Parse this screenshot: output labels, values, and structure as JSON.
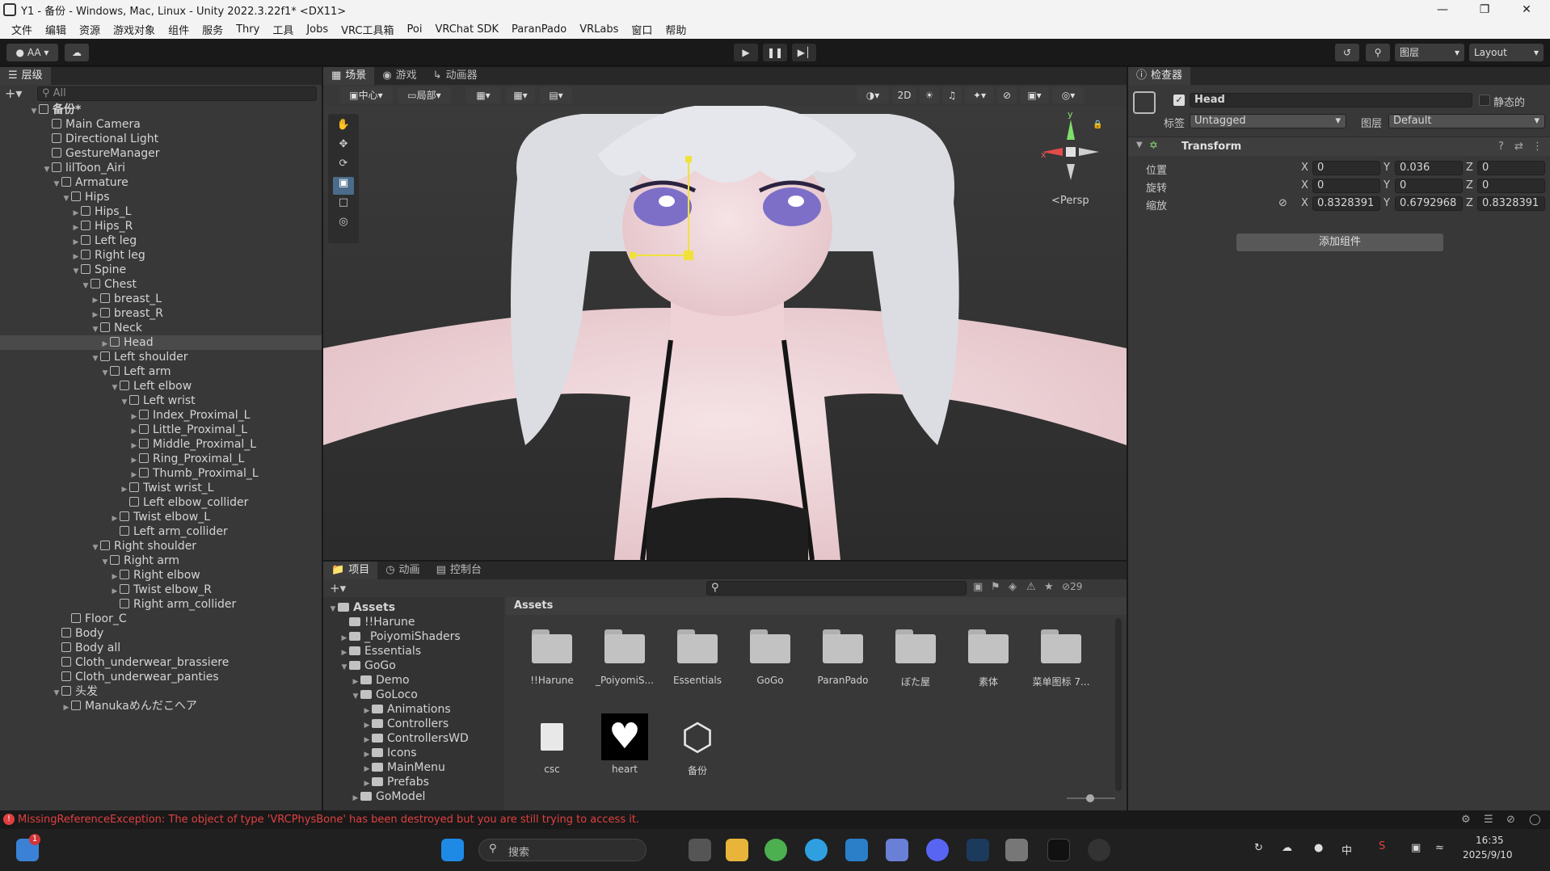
{
  "window": {
    "title": "Y1 - 备份 - Windows, Mac, Linux - Unity 2022.3.22f1* <DX11>"
  },
  "menu": [
    "文件",
    "编辑",
    "资源",
    "游戏对象",
    "组件",
    "服务",
    "Thry",
    "工具",
    "Jobs",
    "VRC工具箱",
    "Poi",
    "VRChat SDK",
    "ParanPado",
    "VRLabs",
    "窗口",
    "帮助"
  ],
  "toolbar": {
    "account": "AA",
    "layers": "图层",
    "layout": "Layout"
  },
  "hierarchy": {
    "tab": "层级",
    "search_placeholder": "All",
    "scene": "备份*",
    "items": [
      {
        "label": "Main Camera",
        "depth": 1,
        "arrow": ""
      },
      {
        "label": "Directional Light",
        "depth": 1,
        "arrow": ""
      },
      {
        "label": "GestureManager",
        "depth": 1,
        "arrow": ""
      },
      {
        "label": "lilToon_Airi",
        "depth": 1,
        "arrow": "▼"
      },
      {
        "label": "Armature",
        "depth": 2,
        "arrow": "▼"
      },
      {
        "label": "Hips",
        "depth": 3,
        "arrow": "▼"
      },
      {
        "label": "Hips_L",
        "depth": 4,
        "arrow": "▶"
      },
      {
        "label": "Hips_R",
        "depth": 4,
        "arrow": "▶"
      },
      {
        "label": "Left leg",
        "depth": 4,
        "arrow": "▶"
      },
      {
        "label": "Right leg",
        "depth": 4,
        "arrow": "▶"
      },
      {
        "label": "Spine",
        "depth": 4,
        "arrow": "▼"
      },
      {
        "label": "Chest",
        "depth": 5,
        "arrow": "▼"
      },
      {
        "label": "breast_L",
        "depth": 6,
        "arrow": "▶"
      },
      {
        "label": "breast_R",
        "depth": 6,
        "arrow": "▶"
      },
      {
        "label": "Neck",
        "depth": 6,
        "arrow": "▼"
      },
      {
        "label": "Head",
        "depth": 7,
        "arrow": "▶",
        "selected": true
      },
      {
        "label": "Left shoulder",
        "depth": 6,
        "arrow": "▼"
      },
      {
        "label": "Left arm",
        "depth": 7,
        "arrow": "▼"
      },
      {
        "label": "Left elbow",
        "depth": 8,
        "arrow": "▼"
      },
      {
        "label": "Left wrist",
        "depth": 9,
        "arrow": "▼"
      },
      {
        "label": "Index_Proximal_L",
        "depth": 10,
        "arrow": "▶"
      },
      {
        "label": "Little_Proximal_L",
        "depth": 10,
        "arrow": "▶"
      },
      {
        "label": "Middle_Proximal_L",
        "depth": 10,
        "arrow": "▶"
      },
      {
        "label": "Ring_Proximal_L",
        "depth": 10,
        "arrow": "▶"
      },
      {
        "label": "Thumb_Proximal_L",
        "depth": 10,
        "arrow": "▶"
      },
      {
        "label": "Twist wrist_L",
        "depth": 9,
        "arrow": "▶"
      },
      {
        "label": "Left elbow_collider",
        "depth": 9,
        "arrow": ""
      },
      {
        "label": "Twist elbow_L",
        "depth": 8,
        "arrow": "▶"
      },
      {
        "label": "Left arm_collider",
        "depth": 8,
        "arrow": ""
      },
      {
        "label": "Right shoulder",
        "depth": 6,
        "arrow": "▼"
      },
      {
        "label": "Right arm",
        "depth": 7,
        "arrow": "▼"
      },
      {
        "label": "Right elbow",
        "depth": 8,
        "arrow": "▶"
      },
      {
        "label": "Twist elbow_R",
        "depth": 8,
        "arrow": "▶"
      },
      {
        "label": "Right arm_collider",
        "depth": 8,
        "arrow": ""
      },
      {
        "label": "Floor_C",
        "depth": 3,
        "arrow": ""
      },
      {
        "label": "Body",
        "depth": 2,
        "arrow": ""
      },
      {
        "label": "Body all",
        "depth": 2,
        "arrow": ""
      },
      {
        "label": "Cloth_underwear_brassiere",
        "depth": 2,
        "arrow": ""
      },
      {
        "label": "Cloth_underwear_panties",
        "depth": 2,
        "arrow": ""
      },
      {
        "label": "头发",
        "depth": 2,
        "arrow": "▼"
      },
      {
        "label": "Manukaめんだこヘア",
        "depth": 3,
        "arrow": "▶"
      }
    ]
  },
  "scene_view": {
    "tabs": [
      "场景",
      "游戏",
      "动画器"
    ],
    "pivot": "中心",
    "space": "局部",
    "mode_2d": "2D",
    "persp": "<Persp",
    "axis_x": "x",
    "axis_y": "y"
  },
  "inspector": {
    "tab": "检查器",
    "object_name": "Head",
    "static_label": "静态的",
    "tag_label": "标签",
    "tag_value": "Untagged",
    "layer_label": "图层",
    "layer_value": "Default",
    "component": "Transform",
    "rows": [
      {
        "label": "位置",
        "x": "0",
        "y": "0.036",
        "z": "0"
      },
      {
        "label": "旋转",
        "x": "0",
        "y": "0",
        "z": "0"
      },
      {
        "label": "缩放",
        "x": "0.8328391",
        "y": "0.6792968",
        "z": "0.8328391"
      }
    ],
    "add_component": "添加组件"
  },
  "project": {
    "tabs": [
      "项目",
      "动画",
      "控制台"
    ],
    "hidden_count": "29",
    "tree": [
      {
        "label": "Assets",
        "depth": 0,
        "arrow": "▼",
        "bold": true
      },
      {
        "label": "!!Harune",
        "depth": 1,
        "arrow": ""
      },
      {
        "label": "_PoiyomiShaders",
        "depth": 1,
        "arrow": "▶"
      },
      {
        "label": "Essentials",
        "depth": 1,
        "arrow": "▶"
      },
      {
        "label": "GoGo",
        "depth": 1,
        "arrow": "▼"
      },
      {
        "label": "Demo",
        "depth": 2,
        "arrow": "▶"
      },
      {
        "label": "GoLoco",
        "depth": 2,
        "arrow": "▼"
      },
      {
        "label": "Animations",
        "depth": 3,
        "arrow": "▶"
      },
      {
        "label": "Controllers",
        "depth": 3,
        "arrow": "▶"
      },
      {
        "label": "ControllersWD",
        "depth": 3,
        "arrow": "▶"
      },
      {
        "label": "Icons",
        "depth": 3,
        "arrow": "▶"
      },
      {
        "label": "MainMenu",
        "depth": 3,
        "arrow": "▶"
      },
      {
        "label": "Prefabs",
        "depth": 3,
        "arrow": "▶"
      },
      {
        "label": "GoModel",
        "depth": 2,
        "arrow": "▶"
      }
    ],
    "breadcrumb": "Assets",
    "assets_row1": [
      "!!Harune",
      "_PoiyomiS...",
      "Essentials",
      "GoGo",
      "ParanPado",
      "ぼた屋",
      "素体",
      "菜单图标 7..."
    ],
    "assets_row2": [
      "csc",
      "heart",
      "备份"
    ]
  },
  "status": {
    "error": "MissingReferenceException: The object of type 'VRCPhysBone' has been destroyed but you are still trying to access it.",
    "color": "#e04040"
  },
  "taskbar": {
    "search": "搜索",
    "ime": "中",
    "time": "16:35",
    "date": "2025/9/10",
    "notif": "1"
  }
}
